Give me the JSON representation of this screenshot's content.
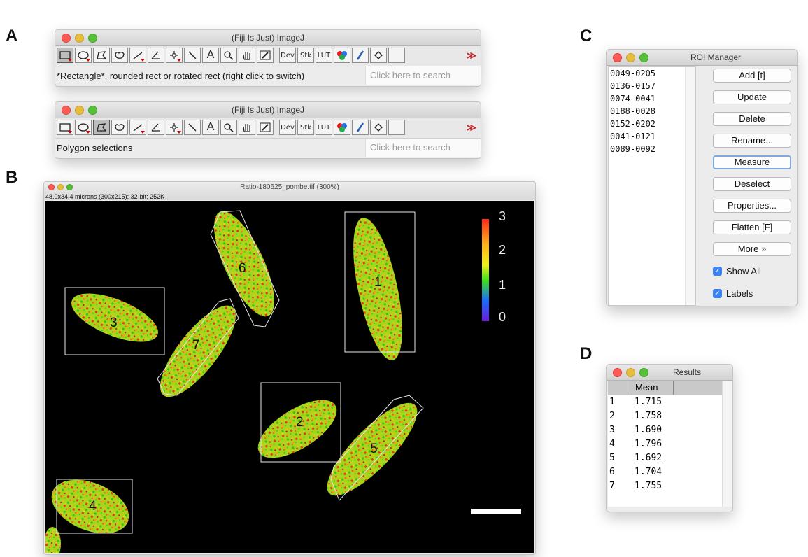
{
  "panels": {
    "a": "A",
    "b": "B",
    "c": "C",
    "d": "D"
  },
  "toolbar_top": {
    "title": "(Fiji Is Just) ImageJ",
    "status": "*Rectangle*, rounded rect or rotated rect (right click to switch)",
    "search_placeholder": "Click here to search"
  },
  "toolbar_bottom": {
    "title": "(Fiji Is Just) ImageJ",
    "status": "Polygon selections",
    "search_placeholder": "Click here to search"
  },
  "tools": {
    "text_tool": "A",
    "dev": "Dev",
    "stk": "Stk",
    "lut": "LUT",
    "more": "≫"
  },
  "image_window": {
    "title": "Ratio-180625_pombe.tif (300%)",
    "info": "48.0x34.4 microns (300x215); 32-bit; 252K",
    "colorbar_labels": [
      "3",
      "2",
      "1",
      "0"
    ],
    "roi_labels": [
      "1",
      "2",
      "3",
      "4",
      "5",
      "6",
      "7"
    ]
  },
  "roi_manager": {
    "title": "ROI Manager",
    "items": [
      "0049-0205",
      "0136-0157",
      "0074-0041",
      "0188-0028",
      "0152-0202",
      "0041-0121",
      "0089-0092"
    ],
    "buttons": [
      "Add [t]",
      "Update",
      "Delete",
      "Rename...",
      "Measure",
      "Deselect",
      "Properties...",
      "Flatten [F]",
      "More »"
    ],
    "show_all": "Show All",
    "labels": "Labels"
  },
  "results": {
    "title": "Results",
    "column": "Mean",
    "rows": [
      {
        "n": "1",
        "mean": "1.715"
      },
      {
        "n": "2",
        "mean": "1.758"
      },
      {
        "n": "3",
        "mean": "1.690"
      },
      {
        "n": "4",
        "mean": "1.796"
      },
      {
        "n": "5",
        "mean": "1.692"
      },
      {
        "n": "6",
        "mean": "1.704"
      },
      {
        "n": "7",
        "mean": "1.755"
      }
    ]
  },
  "colors": {
    "accent_red": "#c2272d",
    "checkbox_blue": "#3b82f6",
    "image_bg": "#000000"
  }
}
